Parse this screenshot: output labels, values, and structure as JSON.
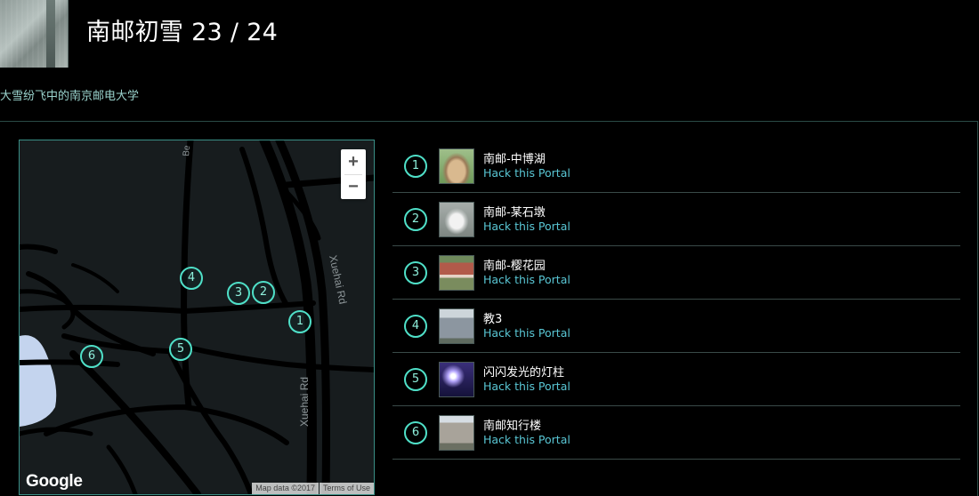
{
  "header": {
    "title": "南邮初雪 23 / 24",
    "description": "大雪纷飞中的南京邮电大学"
  },
  "map": {
    "zoom_in_label": "+",
    "zoom_out_label": "−",
    "logo": "Google",
    "road_labels": {
      "north_road": "Be",
      "xuehai_upper": "Xuehai Rd",
      "xuehai_lower": "Xuehai Rd"
    },
    "attribution": {
      "map_data": "Map data ©2017",
      "terms": "Terms of Use"
    },
    "markers": [
      "1",
      "2",
      "3",
      "4",
      "5",
      "6"
    ]
  },
  "portals": [
    {
      "number": "1",
      "name": "南邮-中博湖",
      "action": "Hack this Portal",
      "thumbnail": "rock-photo"
    },
    {
      "number": "2",
      "name": "南邮-某石墩",
      "action": "Hack this Portal",
      "thumbnail": "stone-pier-photo"
    },
    {
      "number": "3",
      "name": "南邮-樱花园",
      "action": "Hack this Portal",
      "thumbnail": "garden-sign-photo"
    },
    {
      "number": "4",
      "name": "教3",
      "action": "Hack this Portal",
      "thumbnail": "building-photo"
    },
    {
      "number": "5",
      "name": "闪闪发光的灯柱",
      "action": "Hack this Portal",
      "thumbnail": "lamp-post-photo"
    },
    {
      "number": "6",
      "name": "南邮知行楼",
      "action": "Hack this Portal",
      "thumbnail": "building-photo"
    }
  ],
  "colors": {
    "accent": "#4fe0c8",
    "link": "#59c6d4",
    "description": "#9ad3cd",
    "background": "#000000"
  }
}
